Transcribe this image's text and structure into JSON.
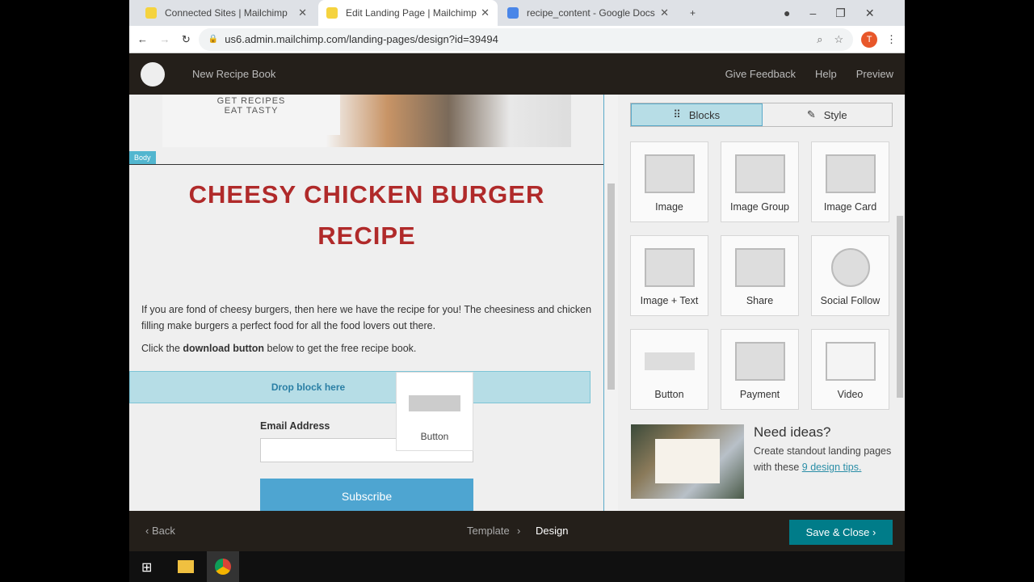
{
  "browser": {
    "tabs": [
      {
        "title": "Connected Sites | Mailchimp"
      },
      {
        "title": "Edit Landing Page | Mailchimp"
      },
      {
        "title": "recipe_content - Google Docs"
      }
    ],
    "url": "us6.admin.mailchimp.com/landing-pages/design?id=39494",
    "avatar": "T"
  },
  "app": {
    "title": "New Recipe Book",
    "nav": [
      "Give Feedback",
      "Help",
      "Preview"
    ]
  },
  "canvas": {
    "hero_text": "GET RECIPES\nEAT TASTY",
    "body_tag": "Body",
    "heading": "CHEESY CHICKEN BURGER RECIPE",
    "para1": "If you are fond of cheesy burgers, then here we have the recipe for you! The cheesiness and chicken filling make burgers a perfect food for all the food lovers out there.",
    "para2_pre": "Click the ",
    "para2_bold": "download button",
    "para2_post": " below to get the free recipe book.",
    "drop": "Drop block here",
    "ghost": "Button",
    "email_label": "Email Address",
    "subscribe": "Subscribe"
  },
  "panel": {
    "tabs": [
      "Blocks",
      "Style"
    ],
    "blocks": [
      "Image",
      "Image Group",
      "Image Card",
      "Image + Text",
      "Share",
      "Social Follow",
      "Button",
      "Payment",
      "Video"
    ],
    "ideas_title": "Need ideas?",
    "ideas_text": "Create standout landing pages with these ",
    "ideas_link": "9 design tips."
  },
  "footer": {
    "back": "Back",
    "steps": [
      "Template",
      "Design"
    ],
    "save": "Save & Close"
  }
}
